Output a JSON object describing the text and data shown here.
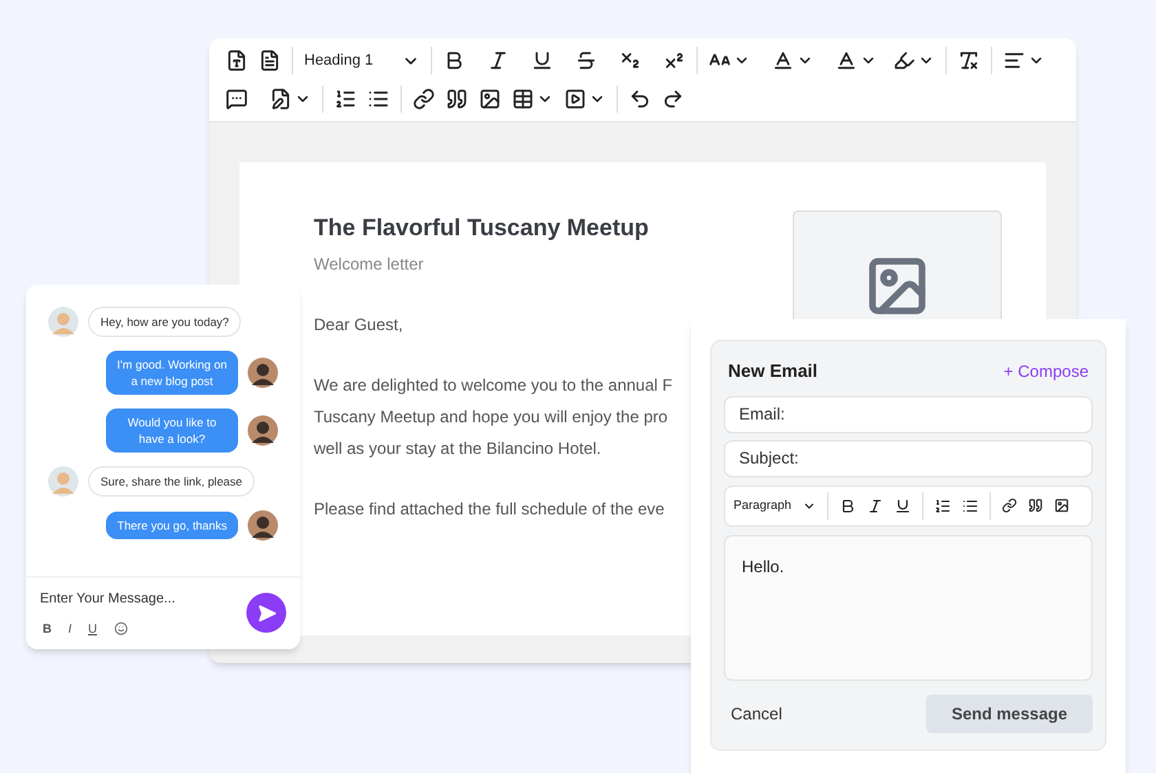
{
  "editor": {
    "heading_select": "Heading 1",
    "document": {
      "title": "The Flavorful Tuscany Meetup",
      "subtitle": "Welcome letter",
      "greeting": "Dear Guest,",
      "paragraph_lines": [
        "We are delighted to welcome you to the annual F",
        "Tuscany Meetup and hope you will enjoy the pro",
        "well as your stay at the Bilancino Hotel."
      ],
      "closing_line": "Please find attached the full schedule of the eve"
    }
  },
  "chat": {
    "messages": [
      {
        "kind": "incoming",
        "text": "Hey, how are you today?"
      },
      {
        "kind": "outgoing",
        "text": "I'm good. Working on a new blog post"
      },
      {
        "kind": "outgoing",
        "text": "Would you like to have a look?"
      },
      {
        "kind": "incoming",
        "text": "Sure, share the link, please"
      },
      {
        "kind": "outgoing",
        "text": "There you go, thanks"
      }
    ],
    "input": {
      "placeholder": "Enter Your Message..."
    },
    "format_buttons": [
      "B",
      "I",
      "U"
    ]
  },
  "email": {
    "title": "New Email",
    "compose": "+ Compose",
    "fields": [
      {
        "placeholder": "Email:"
      },
      {
        "placeholder": "Subject:"
      }
    ],
    "paragraph_select": "Paragraph",
    "body": "Hello.",
    "cancel": "Cancel",
    "send": "Send message"
  }
}
